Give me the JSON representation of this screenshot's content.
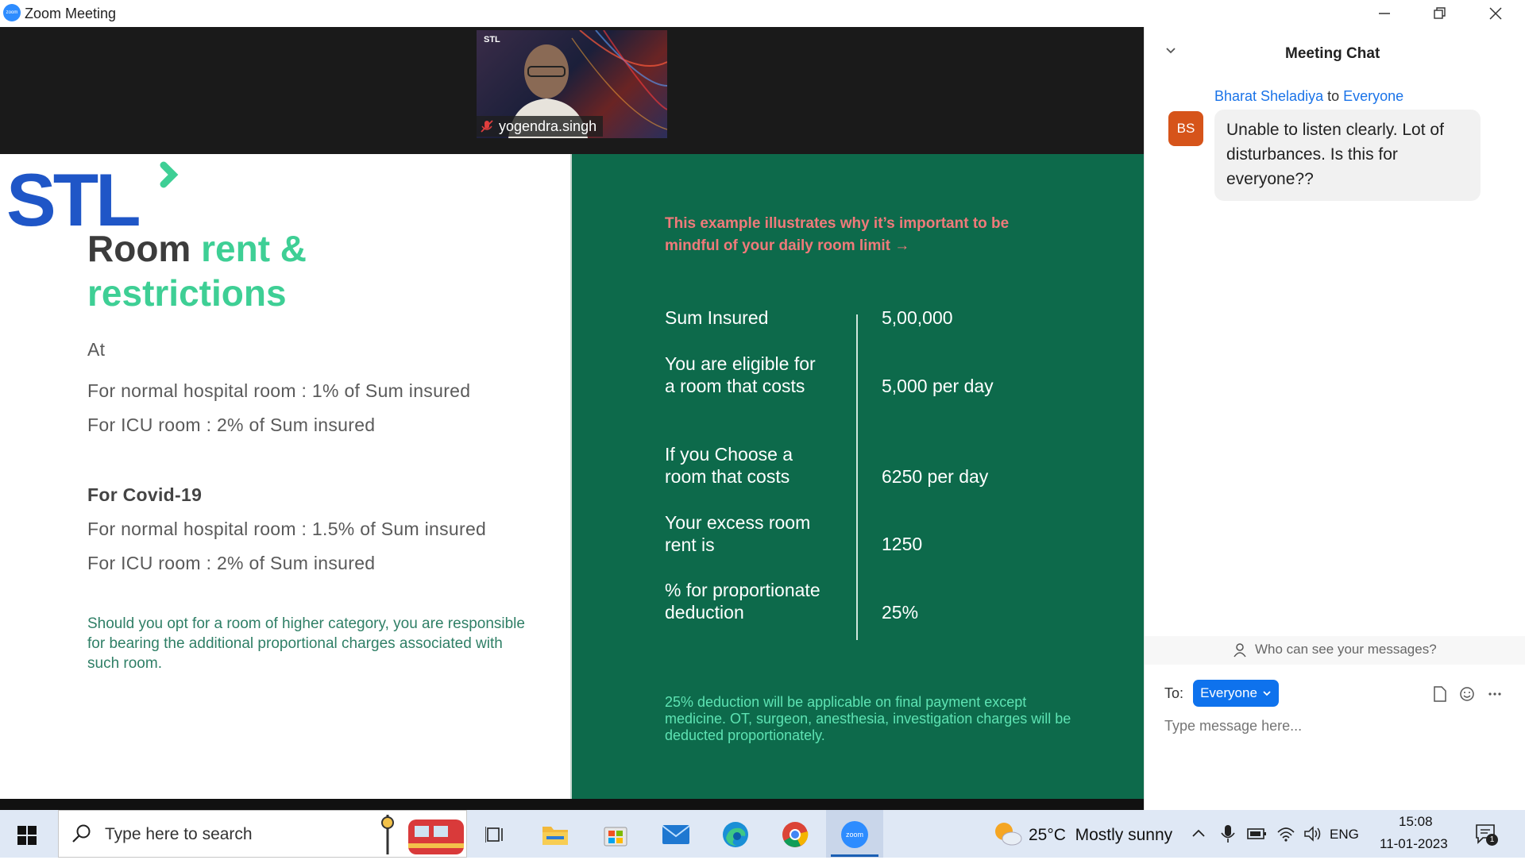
{
  "window": {
    "title": "Zoom Meeting",
    "logo_text": "zoom"
  },
  "video": {
    "participant_name": "yogendra.singh",
    "background_logo": "STL"
  },
  "slide": {
    "logo": "STL",
    "heading_dark": "Room",
    "heading_green_1": "rent &",
    "heading_green_2": "restrictions",
    "at": "At",
    "line1": "For normal hospital room : 1% of Sum insured",
    "line2": "For ICU room : 2% of Sum insured",
    "covid_heading": "For Covid-19",
    "line3": "For normal hospital room : 1.5% of Sum insured",
    "line4": "For ICU room : 2% of Sum insured",
    "note": "Should you opt for a room of higher category, you are responsible for bearing the additional proportional charges associated with such room.",
    "intro": "This example illustrates why it’s important to be mindful of your daily room limit →",
    "rows": [
      {
        "label": "Sum Insured",
        "value": "5,00,000"
      },
      {
        "label": "You are eligible for a room that costs",
        "value": "5,000 per day"
      },
      {
        "label": "If you Choose a room that costs",
        "value": "6250 per day"
      },
      {
        "label": "Your excess room rent is",
        "value": "1250"
      },
      {
        "label": "% for proportionate deduction",
        "value": "25%"
      }
    ],
    "footnote": "25% deduction will be applicable on final payment except medicine. OT, surgeon, anesthesia, investigation charges will be deducted proportionately."
  },
  "chat": {
    "title": "Meeting Chat",
    "sender": "Bharat Sheladiya",
    "to_word": "to",
    "recipient": "Everyone",
    "avatar_initials": "BS",
    "message": "Unable to listen clearly. Lot of disturbances. Is this for everyone??",
    "visibility": "Who can see your messages?",
    "to_label": "To:",
    "to_value": "Everyone",
    "input_placeholder": "Type message here..."
  },
  "taskbar": {
    "search_placeholder": "Type here to search",
    "zoom_label": "zoom",
    "weather_temp": "25°C",
    "weather_desc": "Mostly sunny",
    "language": "ENG",
    "time": "15:08",
    "date": "11-01-2023",
    "notification_count": "1"
  },
  "colors": {
    "zoom_blue": "#2D8CFF",
    "slide_green": "#0d6a4b",
    "stl_blue": "#1f56c7",
    "stl_green": "#3ecf95",
    "avatar": "#d6541a"
  }
}
